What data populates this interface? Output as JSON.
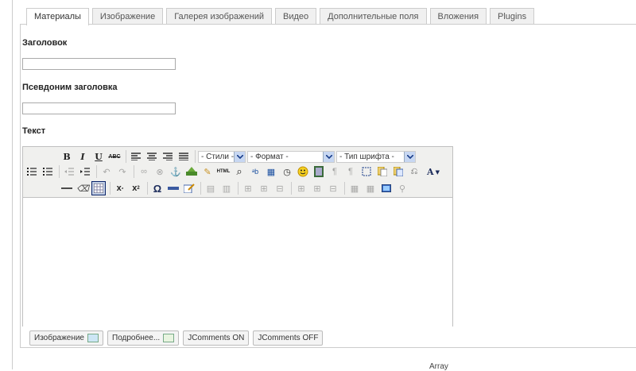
{
  "tabs": [
    {
      "label": "Материалы",
      "active": true
    },
    {
      "label": "Изображение",
      "active": false
    },
    {
      "label": "Галерея изображений",
      "active": false
    },
    {
      "label": "Видео",
      "active": false
    },
    {
      "label": "Дополнительные поля",
      "active": false
    },
    {
      "label": "Вложения",
      "active": false
    },
    {
      "label": "Plugins",
      "active": false
    }
  ],
  "form": {
    "title_label": "Заголовок",
    "title_value": "",
    "alias_label": "Псевдоним заголовка",
    "alias_value": "",
    "text_label": "Текст"
  },
  "editor": {
    "styles_select": "- Стили -",
    "format_select": "- Формат -",
    "font_select": "- Тип шрифта -",
    "abc_label": "ABC",
    "html_label": "HTML"
  },
  "buttons": {
    "image": "Изображение",
    "readmore": "Подробнее...",
    "jcomments_on": "JComments ON",
    "jcomments_off": "JComments OFF"
  },
  "footer": {
    "text": "Array"
  }
}
